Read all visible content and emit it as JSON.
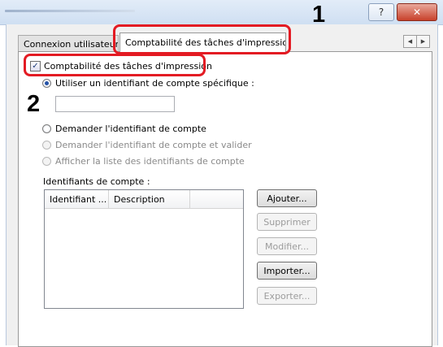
{
  "window": {
    "help_label": "?",
    "close_label": "✕"
  },
  "tabs": [
    {
      "label": "Connexion utilisateur"
    },
    {
      "label": "Comptabilité des tâches d'impression"
    }
  ],
  "tab_scroll": {
    "left": "◀",
    "right": "▶"
  },
  "annotations": {
    "step1": "1",
    "step2": "2"
  },
  "accounting": {
    "enable_label": "Comptabilité des tâches d'impression",
    "enabled": true,
    "options": [
      {
        "label": "Utiliser un identifiant de compte spécifique :",
        "selected": true,
        "enabled": true
      },
      {
        "label": "Demander l'identifiant de compte",
        "selected": false,
        "enabled": true
      },
      {
        "label": "Demander l'identifiant de compte et valider",
        "selected": false,
        "enabled": false
      },
      {
        "label": "Afficher la liste des identifiants de compte",
        "selected": false,
        "enabled": false
      }
    ],
    "account_id_value": ""
  },
  "account_list": {
    "label": "Identifiants de compte :",
    "columns": [
      "Identifiant ...",
      "Description"
    ],
    "rows": []
  },
  "buttons": {
    "add": "Ajouter...",
    "delete": "Supprimer",
    "edit": "Modifier...",
    "import": "Importer...",
    "export": "Exporter..."
  }
}
